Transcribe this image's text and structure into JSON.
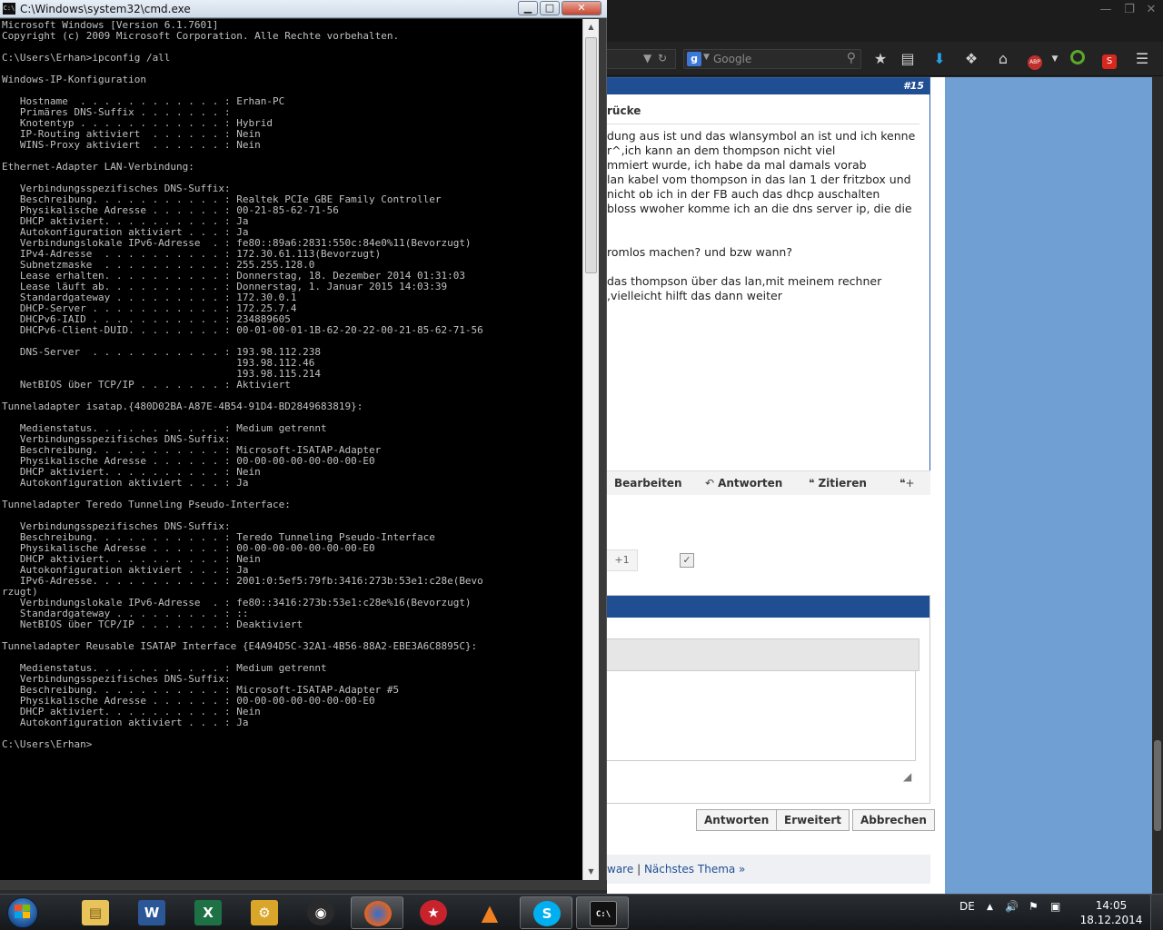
{
  "cmd": {
    "title": "C:\\Windows\\system32\\cmd.exe",
    "lines": [
      "Microsoft Windows [Version 6.1.7601]",
      "Copyright (c) 2009 Microsoft Corporation. Alle Rechte vorbehalten.",
      "",
      "C:\\Users\\Erhan>ipconfig /all",
      "",
      "Windows-IP-Konfiguration",
      "",
      "   Hostname  . . . . . . . . . . . . : Erhan-PC",
      "   Primäres DNS-Suffix . . . . . . . :",
      "   Knotentyp . . . . . . . . . . . . : Hybrid",
      "   IP-Routing aktiviert  . . . . . . : Nein",
      "   WINS-Proxy aktiviert  . . . . . . : Nein",
      "",
      "Ethernet-Adapter LAN-Verbindung:",
      "",
      "   Verbindungsspezifisches DNS-Suffix:",
      "   Beschreibung. . . . . . . . . . . : Realtek PCIe GBE Family Controller",
      "   Physikalische Adresse . . . . . . : 00-21-85-62-71-56",
      "   DHCP aktiviert. . . . . . . . . . : Ja",
      "   Autokonfiguration aktiviert . . . : Ja",
      "   Verbindungslokale IPv6-Adresse  . : fe80::89a6:2831:550c:84e0%11(Bevorzugt)",
      "   IPv4-Adresse  . . . . . . . . . . : 172.30.61.113(Bevorzugt)",
      "   Subnetzmaske  . . . . . . . . . . : 255.255.128.0",
      "   Lease erhalten. . . . . . . . . . : Donnerstag, 18. Dezember 2014 01:31:03",
      "   Lease läuft ab. . . . . . . . . . : Donnerstag, 1. Januar 2015 14:03:39",
      "   Standardgateway . . . . . . . . . : 172.30.0.1",
      "   DHCP-Server . . . . . . . . . . . : 172.25.7.4",
      "   DHCPv6-IAID . . . . . . . . . . . : 234889605",
      "   DHCPv6-Client-DUID. . . . . . . . : 00-01-00-01-1B-62-20-22-00-21-85-62-71-56",
      "",
      "   DNS-Server  . . . . . . . . . . . : 193.98.112.238",
      "                                       193.98.112.46",
      "                                       193.98.115.214",
      "   NetBIOS über TCP/IP . . . . . . . : Aktiviert",
      "",
      "Tunneladapter isatap.{480D02BA-A87E-4B54-91D4-BD2849683819}:",
      "",
      "   Medienstatus. . . . . . . . . . . : Medium getrennt",
      "   Verbindungsspezifisches DNS-Suffix:",
      "   Beschreibung. . . . . . . . . . . : Microsoft-ISATAP-Adapter",
      "   Physikalische Adresse . . . . . . : 00-00-00-00-00-00-00-E0",
      "   DHCP aktiviert. . . . . . . . . . : Nein",
      "   Autokonfiguration aktiviert . . . : Ja",
      "",
      "Tunneladapter Teredo Tunneling Pseudo-Interface:",
      "",
      "   Verbindungsspezifisches DNS-Suffix:",
      "   Beschreibung. . . . . . . . . . . : Teredo Tunneling Pseudo-Interface",
      "   Physikalische Adresse . . . . . . : 00-00-00-00-00-00-00-E0",
      "   DHCP aktiviert. . . . . . . . . . : Nein",
      "   Autokonfiguration aktiviert . . . : Ja",
      "   IPv6-Adresse. . . . . . . . . . . : 2001:0:5ef5:79fb:3416:273b:53e1:c28e(Bevo",
      "rzugt)",
      "   Verbindungslokale IPv6-Adresse  . : fe80::3416:273b:53e1:c28e%16(Bevorzugt)",
      "   Standardgateway . . . . . . . . . : ::",
      "   NetBIOS über TCP/IP . . . . . . . : Deaktiviert",
      "",
      "Tunneladapter Reusable ISATAP Interface {E4A94D5C-32A1-4B56-88A2-EBE3A6C8895C}:",
      "",
      "   Medienstatus. . . . . . . . . . . : Medium getrennt",
      "   Verbindungsspezifisches DNS-Suffix:",
      "   Beschreibung. . . . . . . . . . . : Microsoft-ISATAP-Adapter #5",
      "   Physikalische Adresse . . . . . . : 00-00-00-00-00-00-00-E0",
      "   DHCP aktiviert. . . . . . . . . . : Nein",
      "   Autokonfiguration aktiviert . . . : Ja",
      "",
      "C:\\Users\\Erhan>"
    ]
  },
  "browser": {
    "search_placeholder": "Google",
    "post": {
      "number": "#15",
      "title": "rücke",
      "lines": [
        "dung aus ist und das wlansymbol an ist und ich kenne",
        "r^,ich kann an dem thompson nicht viel",
        "mmiert wurde, ich habe da mal damals vorab",
        " lan kabel vom thompson in das lan 1 der fritzbox und",
        "nicht ob ich in der FB auch das dhcp auschalten",
        "bloss wwoher komme ich an die dns server ip, die die",
        "",
        "romlos machen? und bzw wann?",
        "",
        "das thompson über das lan,mit meinem rechner",
        ",vielleicht hilft das dann weiter"
      ],
      "actions": {
        "edit": "Bearbeiten",
        "reply": "Antworten",
        "quote": "Zitieren"
      }
    },
    "like_label": "+1",
    "buttons": {
      "reply": "Antworten",
      "advanced": "Erweitert",
      "cancel": "Abbrechen"
    },
    "breadcrumb": {
      "prev": "ware",
      "separator": "|",
      "next": "Nächstes Thema »"
    }
  },
  "taskbar": {
    "language": "DE",
    "time": "14:05",
    "date": "18.12.2014"
  }
}
